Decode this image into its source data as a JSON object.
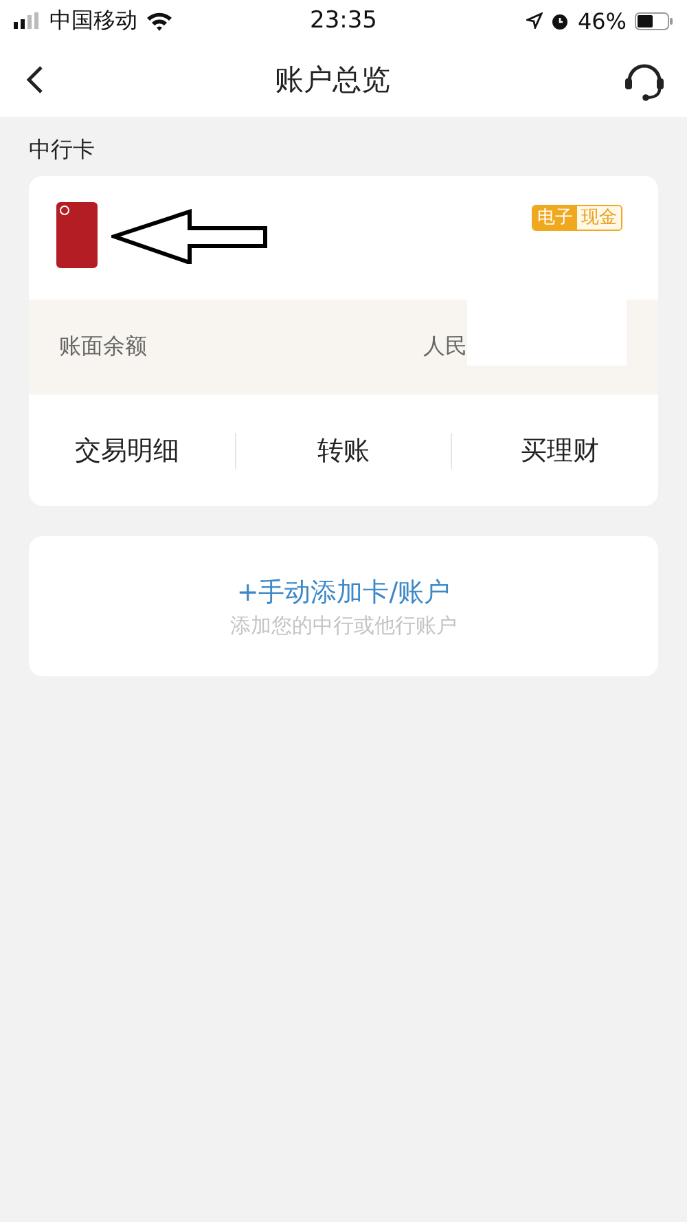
{
  "status_bar": {
    "carrier": "中国移动",
    "time": "23:35",
    "battery": "46%"
  },
  "nav": {
    "title": "账户总览"
  },
  "section_title": "中行卡",
  "card": {
    "badge": [
      "电子",
      "现金"
    ],
    "balance_label": "账面余额",
    "balance_value": "人民",
    "actions": [
      {
        "label": "交易明细"
      },
      {
        "label": "转账"
      },
      {
        "label": "买理财"
      }
    ]
  },
  "add": {
    "title": "+手动添加卡/账户",
    "subtitle": "添加您的中行或他行账户"
  }
}
